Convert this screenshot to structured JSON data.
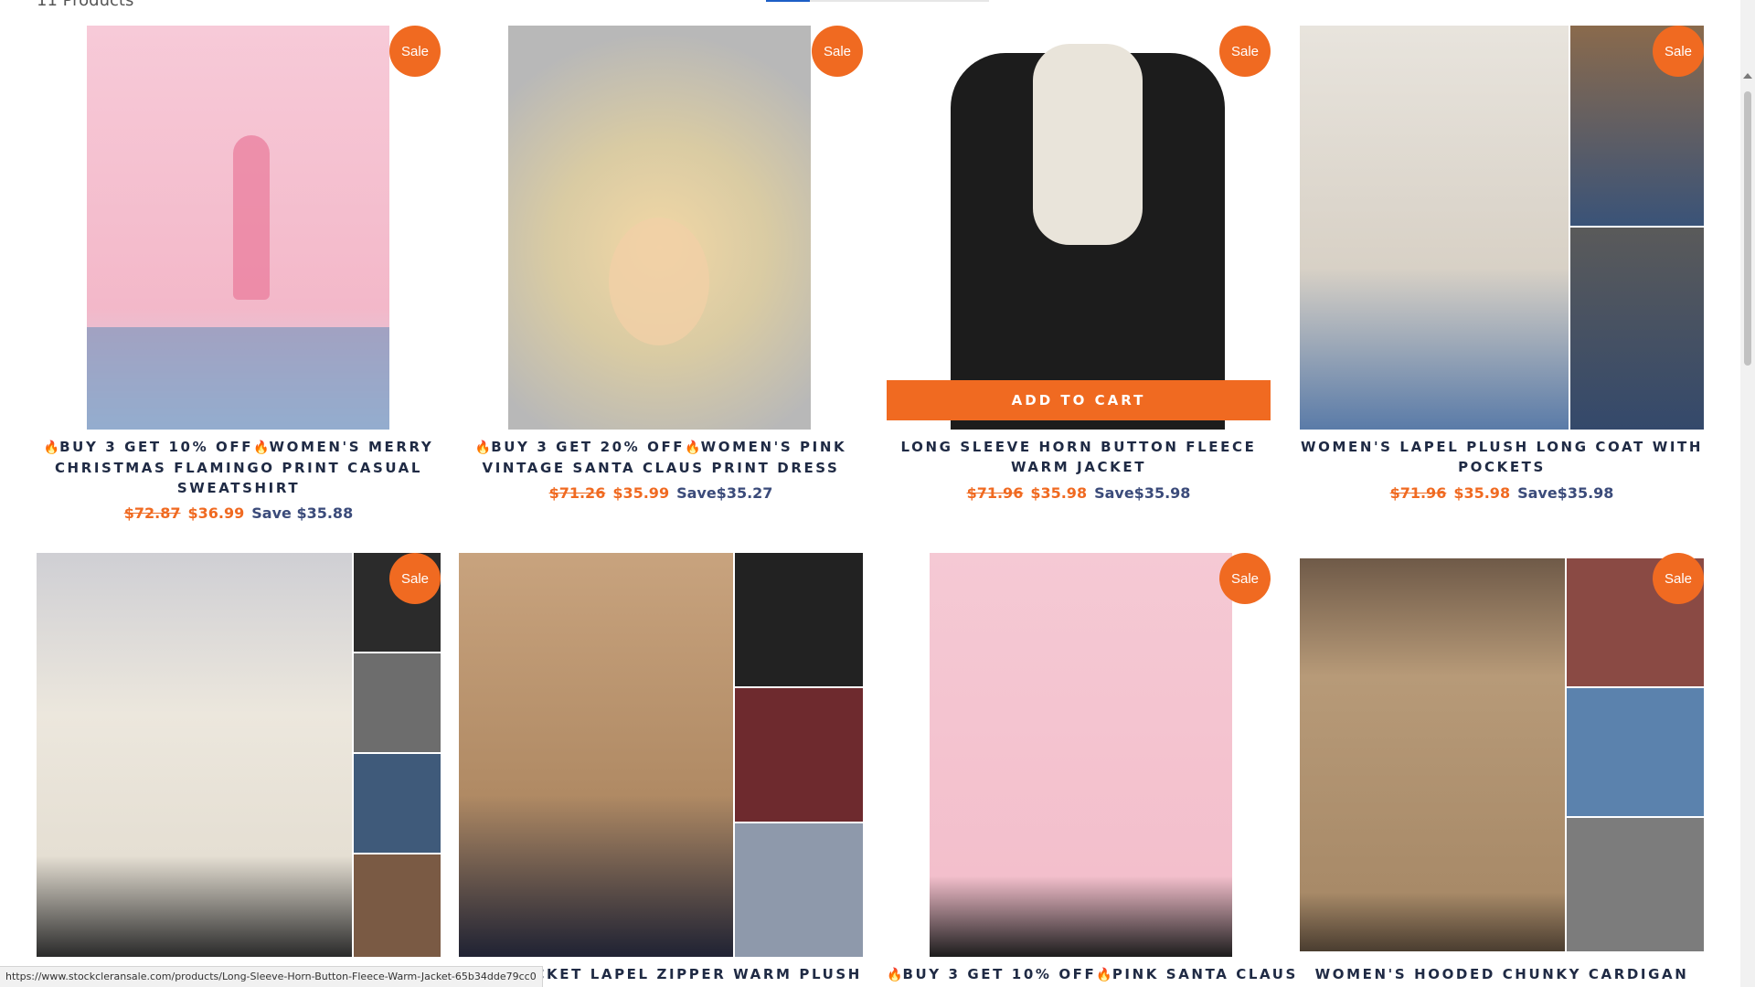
{
  "header": {
    "product_count": "11 Products"
  },
  "products": [
    {
      "badge": "Sale",
      "title_prefix": "BUY 3 GET 10% OFF",
      "title": "WOMEN'S MERRY CHRISTMAS FLAMINGO PRINT CASUAL SWEATSHIRT",
      "old_price": "$72.87",
      "new_price": "$36.99",
      "save": "Save $35.88"
    },
    {
      "badge": "Sale",
      "title_prefix": "BUY 3 GET 20% OFF",
      "title": "WOMEN'S PINK VINTAGE SANTA CLAUS PRINT DRESS",
      "old_price": "$71.26",
      "new_price": "$35.99",
      "save": "Save$35.27"
    },
    {
      "badge": "Sale",
      "add_to_cart": "ADD TO CART",
      "title": "LONG SLEEVE HORN BUTTON FLEECE WARM JACKET",
      "old_price": "$71.96",
      "new_price": "$35.98",
      "save": "Save$35.98"
    },
    {
      "badge": "Sale",
      "title": "WOMEN'S LAPEL PLUSH LONG COAT WITH POCKETS",
      "old_price": "$71.96",
      "new_price": "$35.98",
      "save": "Save$35.98"
    },
    {
      "badge": "Sale",
      "title": ""
    },
    {
      "title": "JACKET LAPEL ZIPPER WARM PLUSH"
    },
    {
      "badge": "Sale",
      "title_prefix": "BUY 3 GET 10% OFF",
      "title": "PINK SANTA CLAUS"
    },
    {
      "badge": "Sale",
      "title": "WOMEN'S HOODED CHUNKY CARDIGAN"
    }
  ],
  "status_url": "https://www.stockcleransale.com/products/Long-Sleeve-Horn-Button-Fleece-Warm-Jacket-65b34dde79cc0",
  "colors": {
    "accent": "#f06a21",
    "title": "#1f2a44",
    "save": "#3b4b7a"
  },
  "icons": [
    "fire-icon",
    "sale-badge"
  ]
}
